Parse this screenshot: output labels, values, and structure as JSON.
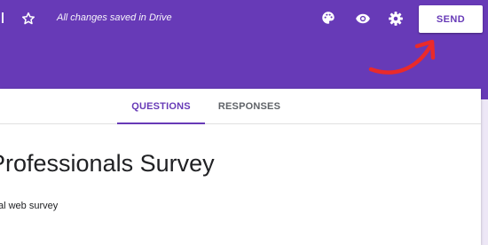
{
  "header": {
    "save_status": "All changes saved in Drive",
    "send_label": "SEND",
    "icons": [
      "star-icon",
      "palette-icon",
      "eye-icon",
      "gear-icon"
    ],
    "color": "#673ab7"
  },
  "tabs": [
    {
      "label": "QUESTIONS",
      "active": true
    },
    {
      "label": "RESPONSES",
      "active": false
    }
  ],
  "form": {
    "title": "Professionals Survey",
    "description": "al web survey"
  },
  "annotation": {
    "color": "#ea2a2a",
    "shape": "curved-arrow"
  }
}
